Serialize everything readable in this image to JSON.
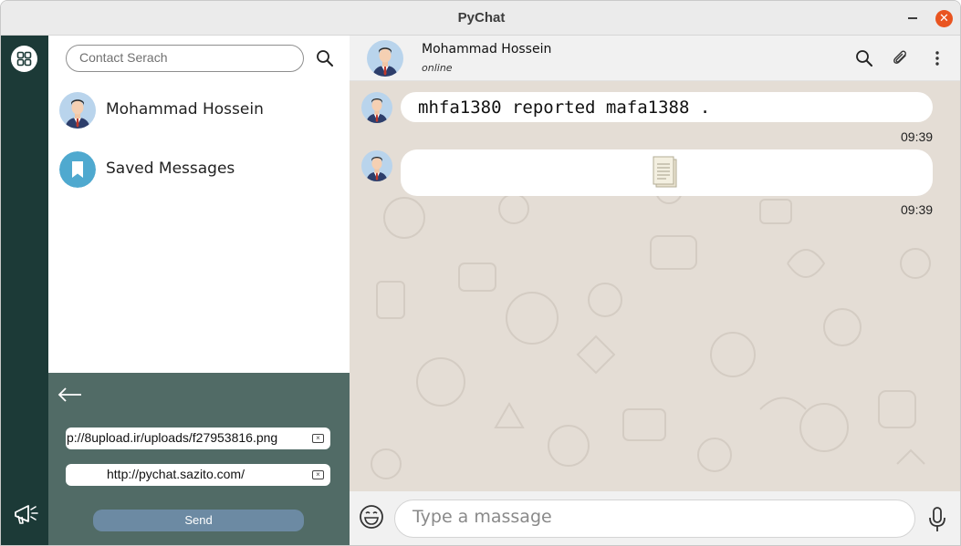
{
  "window": {
    "title": "PyChat",
    "controls": {
      "minimize": "minimize-icon",
      "maximize": "maximize-icon",
      "close": "close-icon"
    },
    "close_glyph": "✕"
  },
  "rail": {
    "menu_icon": "apps-grid-icon",
    "announce_icon": "megaphone-icon",
    "color": "#1c3a37"
  },
  "contacts": {
    "search": {
      "placeholder": "Contact Serach",
      "icon": "search-icon"
    },
    "items": [
      {
        "name": "Mohammad Hossein",
        "avatar": "user-avatar"
      },
      {
        "name": "Saved Messages",
        "avatar": "bookmark-icon"
      }
    ]
  },
  "settings_panel": {
    "back_icon": "arrow-left-icon",
    "fields": [
      {
        "value": "p://8upload.ir/uploads/f27953816.png",
        "clear_icon": "clear-icon"
      },
      {
        "value": "http://pychat.sazito.com/",
        "clear_icon": "clear-icon"
      }
    ],
    "send_label": "Send",
    "color": "#516b66"
  },
  "chat": {
    "header": {
      "name": "Mohammad Hossein",
      "status": "online",
      "icons": [
        "search-icon",
        "paperclip-icon",
        "more-vertical-icon"
      ]
    },
    "messages": [
      {
        "text": "mhfa1380  reported  mafa1388 .",
        "time": "09:39",
        "kind": "text"
      },
      {
        "text": "",
        "time": "09:39",
        "kind": "document",
        "icon": "document-icon"
      }
    ],
    "background": "#e4ddd5"
  },
  "composer": {
    "placeholder": "Type a massage",
    "emoji_icon": "emoji-icon",
    "mic_icon": "microphone-icon"
  }
}
